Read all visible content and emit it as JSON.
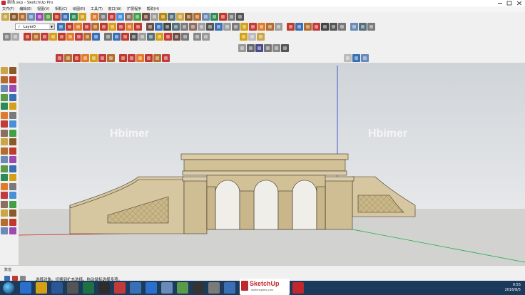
{
  "window": {
    "title": "新场.skp - SketchUp Pro"
  },
  "menu": [
    "文件(F)",
    "编辑(E)",
    "视图(V)",
    "相机(C)",
    "绘图(R)",
    "工具(T)",
    "窗口(W)",
    "扩展程序",
    "帮助(H)"
  ],
  "layer_selector": {
    "value": "Layer0"
  },
  "viewport": {
    "watermarks": [
      "Hbimer",
      "Hbimer"
    ],
    "sky_color": "#dfe3e7",
    "ground_color": "#d2d2d0",
    "wall_color": "#d7c7a0"
  },
  "status": {
    "measure_label": "数值",
    "hint": "选择对象。切换到扩充选择。拖动鼠标选择多项。"
  },
  "logo": {
    "name": "SketchUp",
    "sub": "sketchupbbs.com"
  },
  "taskbar": {
    "time": "9:55",
    "date": "2016/8/5"
  },
  "colors": {
    "accent": "#c0282d",
    "axis_red": "#cc2222",
    "axis_green": "#22aa44",
    "axis_blue": "#2233cc"
  }
}
